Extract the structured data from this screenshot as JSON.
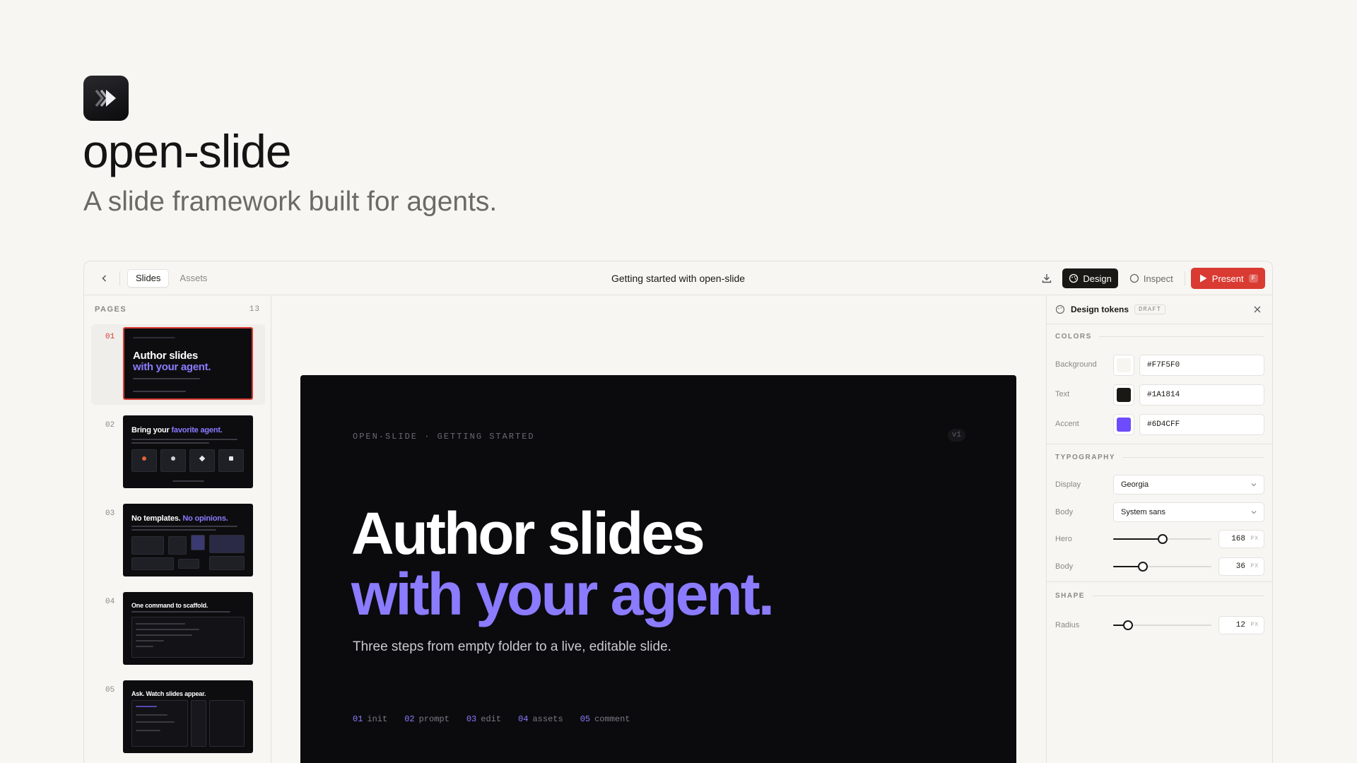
{
  "hero": {
    "title": "open-slide",
    "tagline": "A slide framework built for agents."
  },
  "toolbar": {
    "tabs": [
      "Slides",
      "Assets"
    ],
    "doc_title": "Getting started with open-slide",
    "design_label": "Design",
    "inspect_label": "Inspect",
    "present_label": "Present",
    "present_shortcut": "F"
  },
  "pages": {
    "header": "PAGES",
    "count": "13",
    "items": [
      {
        "num": "01",
        "title": "Author slides",
        "title_accent": "with your agent."
      },
      {
        "num": "02",
        "title": "Bring your ",
        "title_accent": "favorite agent."
      },
      {
        "num": "03",
        "title": "No templates. ",
        "title_accent": "No opinions."
      },
      {
        "num": "04",
        "title": "One command to scaffold.",
        "title_accent": ""
      },
      {
        "num": "05",
        "title": "Ask. Watch slides appear.",
        "title_accent": ""
      }
    ]
  },
  "slide": {
    "eyebrow": "OPEN-SLIDE · GETTING STARTED",
    "version": "v1",
    "headline": "Author slides",
    "headline_accent": "with your agent.",
    "subtitle": "Three steps from empty folder to a live, editable slide.",
    "steps": [
      {
        "n": "01",
        "label": "init"
      },
      {
        "n": "02",
        "label": "prompt"
      },
      {
        "n": "03",
        "label": "edit"
      },
      {
        "n": "04",
        "label": "assets"
      },
      {
        "n": "05",
        "label": "comment"
      }
    ]
  },
  "tokens": {
    "title": "Design tokens",
    "badge": "DRAFT",
    "colors_title": "COLORS",
    "colors": [
      {
        "label": "Background",
        "hex": "#F7F5F0",
        "swatch": "#f7f5f0"
      },
      {
        "label": "Text",
        "hex": "#1A1814",
        "swatch": "#1a1814"
      },
      {
        "label": "Accent",
        "hex": "#6D4CFF",
        "swatch": "#6d4cff"
      }
    ],
    "typography_title": "TYPOGRAPHY",
    "display_label": "Display",
    "display_value": "Georgia",
    "body_label": "Body",
    "body_value": "System sans",
    "hero_label": "Hero",
    "hero_size": "168",
    "hero_fraction": 0.5,
    "body_size_label": "Body",
    "body_size": "36",
    "body_fraction": 0.3,
    "shape_title": "SHAPE",
    "radius_label": "Radius",
    "radius_value": "12",
    "radius_fraction": 0.15,
    "unit": "PX"
  },
  "colors": {
    "accent": "#8b7bff",
    "present": "#d93a32"
  }
}
